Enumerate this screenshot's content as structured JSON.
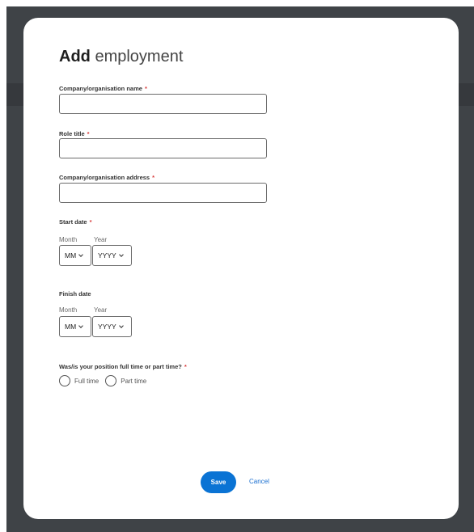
{
  "dialog": {
    "title_bold": "Add",
    "title_rest": "employment"
  },
  "fields": {
    "company_name": {
      "label": "Company/organisation name",
      "required": "*",
      "value": ""
    },
    "role_title": {
      "label": "Role title",
      "required": "*",
      "value": ""
    },
    "company_address": {
      "label": "Company/organisation address",
      "required": "*",
      "value": ""
    }
  },
  "start_date": {
    "label": "Start date",
    "required": "*",
    "month_label": "Month",
    "year_label": "Year",
    "month_value": "MM",
    "year_value": "YYYY"
  },
  "finish_date": {
    "label": "Finish date",
    "month_label": "Month",
    "year_label": "Year",
    "month_value": "MM",
    "year_value": "YYYY"
  },
  "position_type": {
    "label": "Was/is your position full time or part time?",
    "required": "*",
    "options": [
      "Full time",
      "Part time"
    ]
  },
  "actions": {
    "save_label": "Save",
    "cancel_label": "Cancel"
  },
  "colors": {
    "primary": "#0a73d4",
    "required": "#d83b3b",
    "backdrop": "#3f4347"
  }
}
